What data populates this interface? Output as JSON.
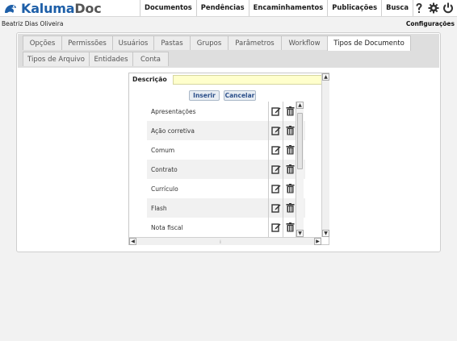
{
  "app": {
    "logo_part1": "Kaluma",
    "logo_part2": "Doc"
  },
  "nav": {
    "items": [
      "Documentos",
      "Pendências",
      "Encaminhamentos",
      "Publicações",
      "Busca"
    ]
  },
  "top_icons": [
    "help-icon",
    "gear-icon",
    "power-icon"
  ],
  "user": {
    "name": "Beatriz Dias Oliveira"
  },
  "config_link": "Configurações",
  "tabs": {
    "row1": [
      "Opções",
      "Permissões",
      "Usuários",
      "Pastas",
      "Grupos",
      "Parâmetros",
      "Workflow",
      "Tipos de Documento"
    ],
    "row2": [
      "Tipos de Arquivo",
      "Entidades",
      "Conta"
    ],
    "active": "Tipos de Documento"
  },
  "form": {
    "description_label": "Descrição",
    "description_value": "",
    "insert_label": "Inserir",
    "cancel_label": "Cancelar"
  },
  "document_types": [
    "Apresentações",
    "Ação corretiva",
    "Comum",
    "Contrato",
    "Currículo",
    "Flash",
    "Nota fiscal"
  ],
  "row_actions": [
    "edit-icon",
    "trash-icon"
  ],
  "colors": {
    "brand_blue": "#1e5fa8",
    "input_highlight": "#ffffcc",
    "button_text": "#2b4f8a"
  }
}
